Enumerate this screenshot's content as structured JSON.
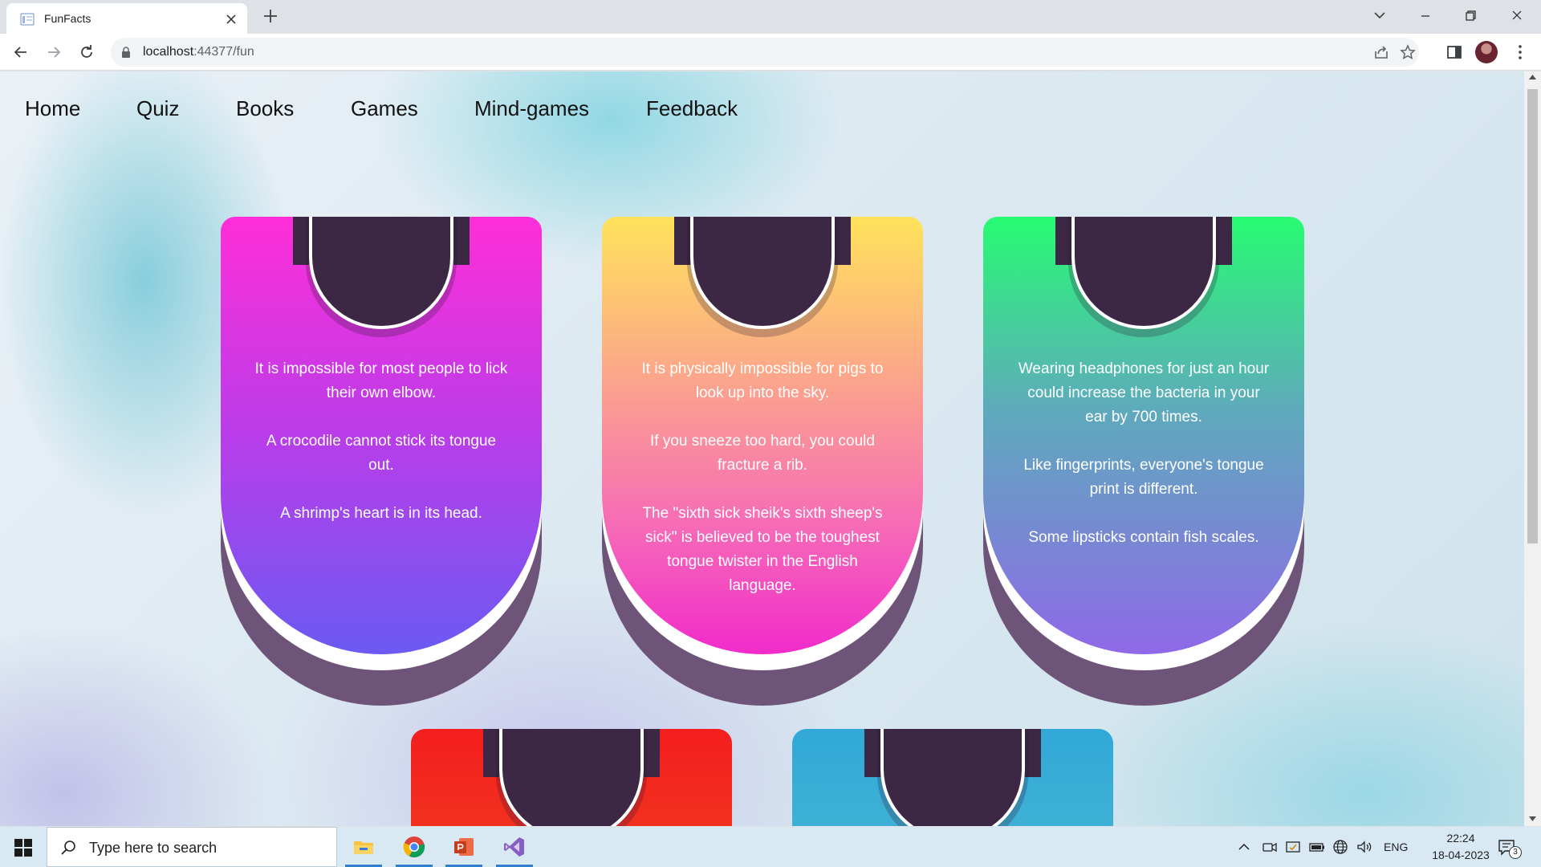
{
  "browser": {
    "tab_title": "FunFacts",
    "url_host": "localhost",
    "url_rest": ":44377/fun"
  },
  "nav": {
    "items": [
      "Home",
      "Quiz",
      "Books",
      "Games",
      "Mind-games",
      "Feedback"
    ]
  },
  "cards": [
    {
      "facts": [
        "It is impossible for most people to lick their own elbow.",
        "A crocodile cannot stick its tongue out.",
        "A shrimp's heart is in its head."
      ]
    },
    {
      "facts": [
        "It is physically impossible for pigs to look up into the sky.",
        "If you sneeze too hard, you could fracture a rib.",
        "The \"sixth sick sheik's sixth sheep's sick\" is believed to be the toughest tongue twister in the English language."
      ]
    },
    {
      "facts": [
        "Wearing headphones for just an hour could increase the bacteria in your ear by 700 times.",
        "Like fingerprints, everyone's tongue print is different.",
        "Some lipsticks contain fish scales."
      ]
    }
  ],
  "taskbar": {
    "search_placeholder": "Type here to search",
    "language": "ENG",
    "time": "22:24",
    "date": "18-04-2023",
    "notification_count": "3"
  },
  "colors": {
    "card_notch": "#3c2744",
    "card_1_top": "#ff2ed8",
    "card_2_top": "#ffe35a",
    "card_3_top": "#28fb72",
    "card_4_top": "#f31d1e",
    "card_5_top": "#31a8d8"
  },
  "icons": [
    "tab-favicon-icon",
    "close-icon",
    "plus-icon",
    "chevron-down-icon",
    "minimize-icon",
    "maximize-icon",
    "back-arrow-icon",
    "forward-arrow-icon",
    "reload-icon",
    "lock-icon",
    "share-icon",
    "star-icon",
    "sidebar-icon",
    "kebab-menu-icon",
    "windows-start-icon",
    "search-icon",
    "file-explorer-icon",
    "chrome-icon",
    "powerpoint-icon",
    "visual-studio-icon",
    "notification-icon"
  ]
}
